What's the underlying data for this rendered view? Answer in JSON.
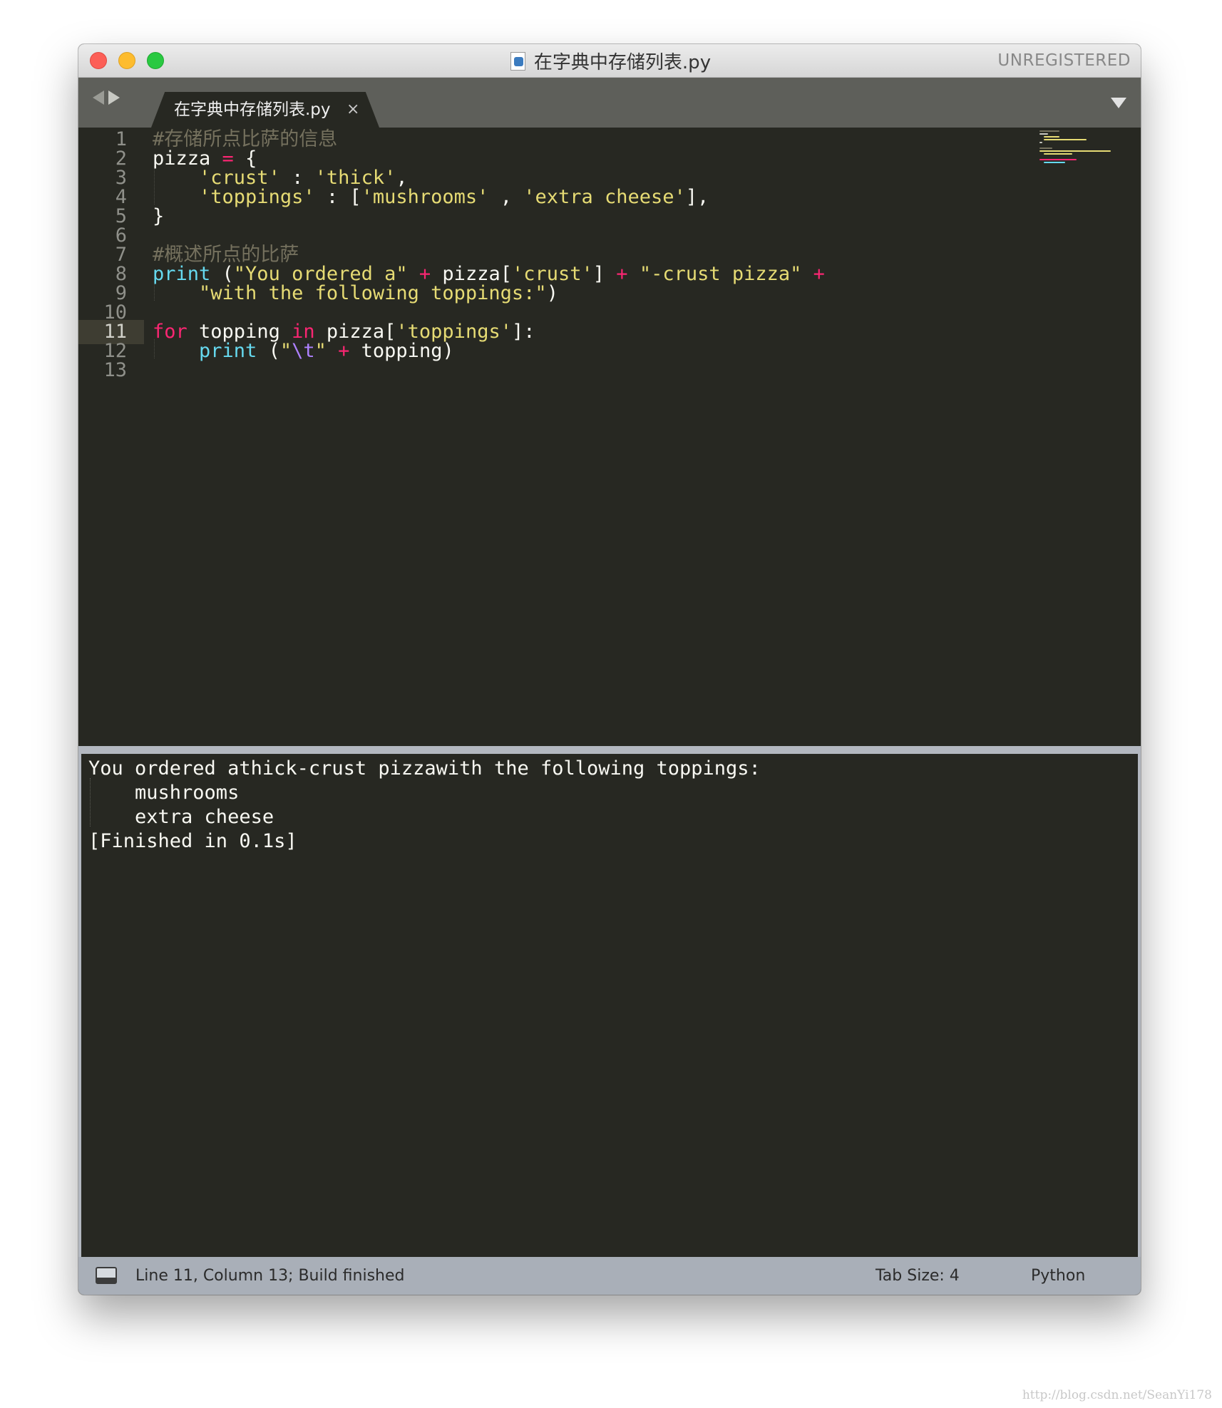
{
  "window": {
    "title": "在字典中存储列表.py",
    "unregistered": "UNREGISTERED"
  },
  "tab": {
    "label": "在字典中存储列表.py",
    "close": "×"
  },
  "editor": {
    "line_numbers": [
      "1",
      "2",
      "3",
      "4",
      "5",
      "6",
      "7",
      "8",
      "9",
      "10",
      "11",
      "12",
      "13"
    ],
    "active_line": "11",
    "lines": {
      "l1": {
        "t0": "#存储所点比萨的信息"
      },
      "l2": {
        "t0": "pizza ",
        "t1": "=",
        "t2": " {"
      },
      "l3": {
        "t0": "    ",
        "t1": "'crust'",
        "t2": " : ",
        "t3": "'thick'",
        "t4": ","
      },
      "l4": {
        "t0": "    ",
        "t1": "'toppings'",
        "t2": " : [",
        "t3": "'mushrooms'",
        "t4": " , ",
        "t5": "'extra cheese'",
        "t6": "],"
      },
      "l5": {
        "t0": "}"
      },
      "l7": {
        "t0": "#概述所点的比萨"
      },
      "l8": {
        "t0": "print",
        "t1": " (",
        "t2": "\"You ordered a\"",
        "t3": " ",
        "t4": "+",
        "t5": " pizza[",
        "t6": "'crust'",
        "t7": "] ",
        "t8": "+",
        "t9": " ",
        "t10": "\"-crust pizza\"",
        "t11": " ",
        "t12": "+"
      },
      "l9": {
        "t0": "    ",
        "t1": "\"with the following toppings:\"",
        "t2": ")"
      },
      "l11": {
        "t0": "for",
        "t1": " topping ",
        "t2": "in",
        "t3": " pizza[",
        "t4": "'toppings'",
        "t5": "]:"
      },
      "l12": {
        "t0": "    ",
        "t1": "print",
        "t2": " (",
        "t3": "\"",
        "t4": "\\t",
        "t5": "\"",
        "t6": " ",
        "t7": "+",
        "t8": " topping)"
      }
    }
  },
  "output": {
    "lines": [
      "You ordered athick-crust pizzawith the following toppings:",
      "\tmushrooms",
      "\textra cheese",
      "[Finished in 0.1s]"
    ]
  },
  "status": {
    "position": "Line 11, Column 13; Build finished",
    "tab_size": "Tab Size: 4",
    "syntax": "Python"
  },
  "watermark": "http://blog.csdn.net/SeanYi178",
  "colors": {
    "background": "#272822",
    "comment": "#75715e",
    "string": "#e6db74",
    "keyword": "#f92672",
    "function": "#66d9ef",
    "escape": "#ae81ff",
    "foreground": "#f8f8f2"
  },
  "icons": [
    "close-icon",
    "minimize-icon",
    "maximize-icon",
    "python-file-icon",
    "back-arrow-icon",
    "forward-arrow-icon",
    "tab-close-icon",
    "dropdown-arrow-icon",
    "output-panel-icon"
  ]
}
